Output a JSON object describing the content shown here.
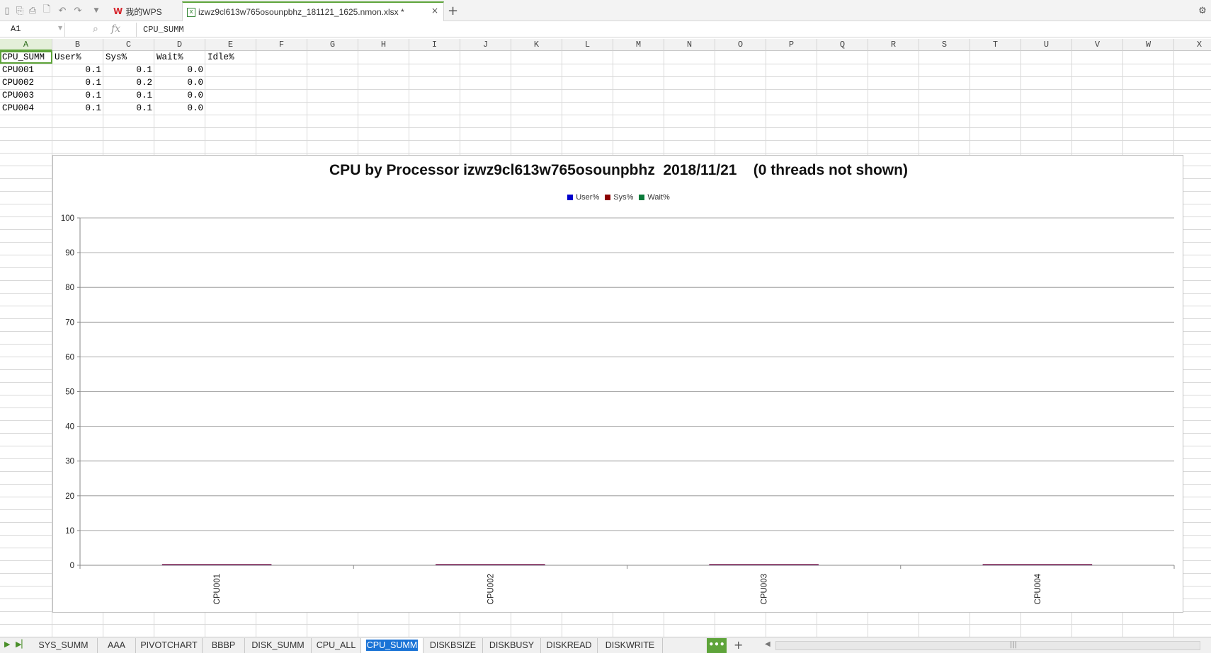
{
  "titlebar": {
    "wps_tab_label": "我的WPS",
    "doc_tab_label": "izwz9cl613w765osounpbhz_181121_1625.nmon.xlsx *",
    "close_glyph": "×",
    "new_tab_glyph": "+"
  },
  "formula_bar": {
    "cell_ref": "A1",
    "fx_label": "fx",
    "content": "CPU_SUMM"
  },
  "columns": [
    "A",
    "B",
    "C",
    "D",
    "E",
    "F",
    "G",
    "H",
    "I",
    "J",
    "K",
    "L",
    "M",
    "N",
    "O",
    "P",
    "Q",
    "R",
    "S",
    "T",
    "U",
    "V",
    "W",
    "X"
  ],
  "sheet_rows": [
    [
      "CPU_SUMM",
      "User%",
      "Sys%",
      "Wait%",
      "Idle%"
    ],
    [
      "CPU001",
      "0.1",
      "0.1",
      "0.0",
      ""
    ],
    [
      "CPU002",
      "0.1",
      "0.2",
      "0.0",
      ""
    ],
    [
      "CPU003",
      "0.1",
      "0.1",
      "0.0",
      ""
    ],
    [
      "CPU004",
      "0.1",
      "0.1",
      "0.0",
      ""
    ]
  ],
  "chart_data": {
    "type": "bar",
    "title": "CPU by Processor izwz9cl613w765osounpbhz  2018/11/21    (0 threads not shown)",
    "categories": [
      "CPU001",
      "CPU002",
      "CPU003",
      "CPU004"
    ],
    "series": [
      {
        "name": "User%",
        "color": "#0000cc",
        "values": [
          0.1,
          0.1,
          0.1,
          0.1
        ]
      },
      {
        "name": "Sys%",
        "color": "#8b0000",
        "values": [
          0.1,
          0.2,
          0.1,
          0.1
        ]
      },
      {
        "name": "Wait%",
        "color": "#0a7a3a",
        "values": [
          0.0,
          0.0,
          0.0,
          0.0
        ]
      }
    ],
    "stacked": true,
    "ylim": [
      0,
      100
    ],
    "yticks": [
      0,
      10,
      20,
      30,
      40,
      50,
      60,
      70,
      80,
      90,
      100
    ],
    "grid": true,
    "legend": "top-center",
    "xlabel": "",
    "ylabel": ""
  },
  "sheet_tabs": [
    "SYS_SUMM",
    "AAA",
    "PIVOTCHART",
    "BBBP",
    "DISK_SUMM",
    "CPU_ALL",
    "CPU_SUMM",
    "DISKBSIZE",
    "DISKBUSY",
    "DISKREAD",
    "DISKWRITE"
  ],
  "active_sheet": "CPU_SUMM",
  "sheet_nav": {
    "more_label": "•••",
    "add_label": "+"
  }
}
